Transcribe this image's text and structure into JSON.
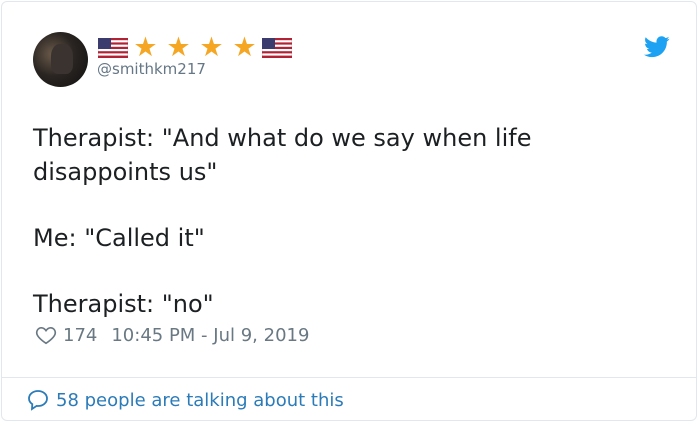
{
  "tweet": {
    "display_name_icons": [
      "us-flag-icon",
      "star-icon",
      "star-icon",
      "star-icon",
      "star-icon",
      "us-flag-icon"
    ],
    "handle": "@smithkm217",
    "lines": [
      "Therapist: \"And what do we say when life disappoints us\"",
      "Me: \"Called it\"",
      "Therapist: \"no\""
    ],
    "likes": "174",
    "timestamp": "10:45 PM - Jul 9, 2019",
    "footer_text": "58 people are talking about this"
  },
  "colors": {
    "text": "#1c2022",
    "muted": "#697882",
    "link": "#2b7bb9",
    "twitter_blue": "#1da1f2",
    "star": "#f5a623"
  }
}
